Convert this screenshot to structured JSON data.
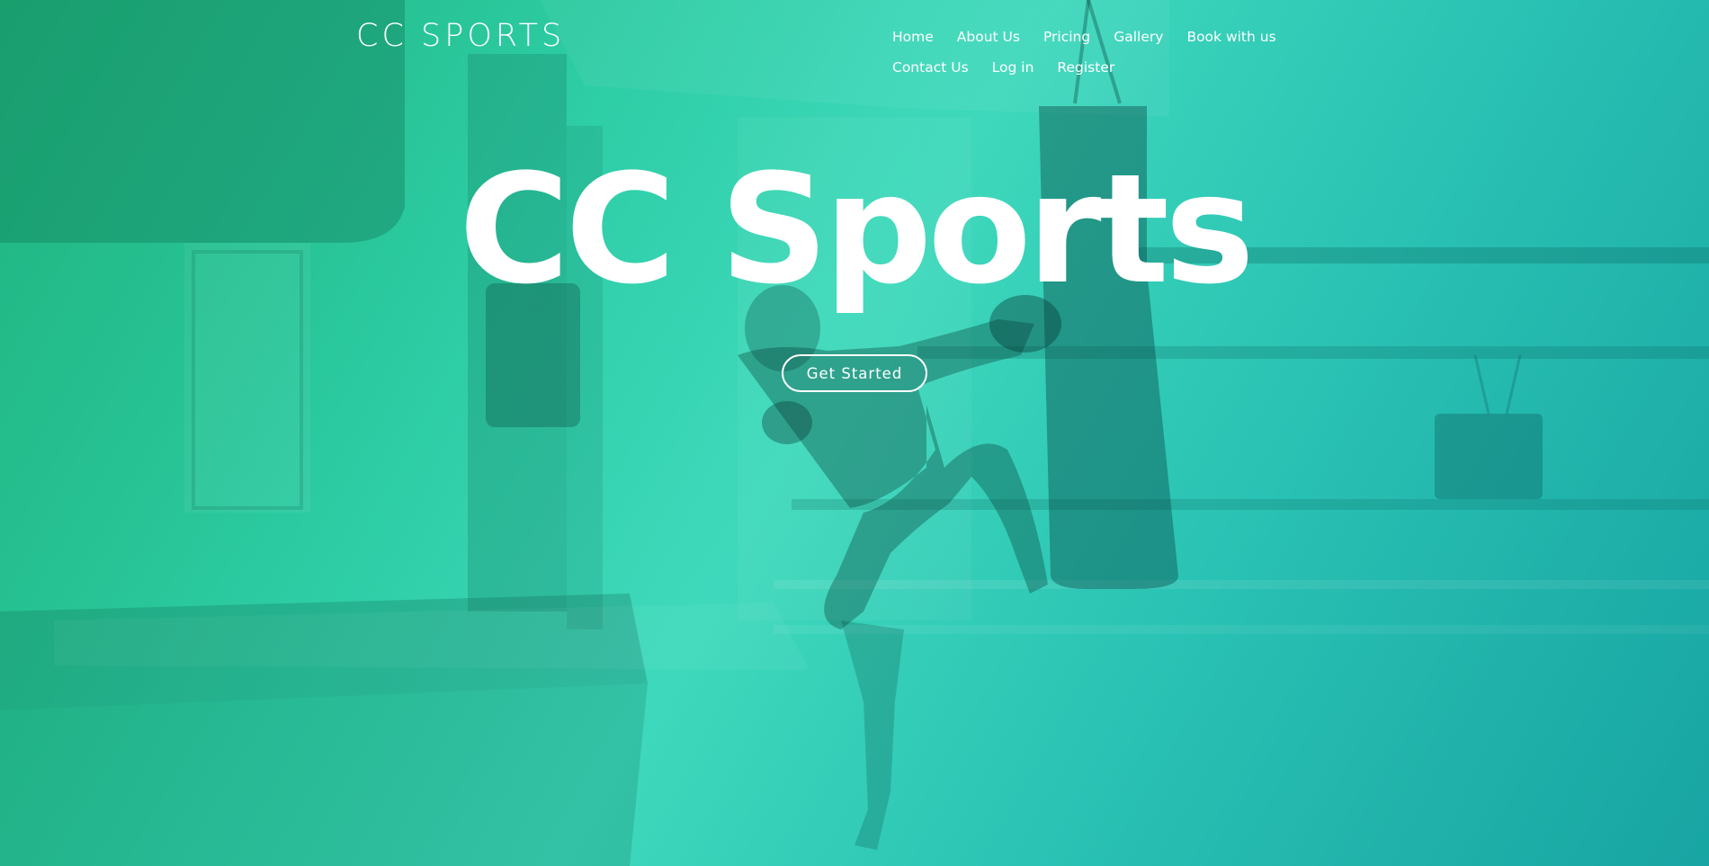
{
  "header": {
    "logo_text": "CC SPORTS",
    "nav_items": [
      {
        "label": "Home"
      },
      {
        "label": "About Us"
      },
      {
        "label": "Pricing"
      },
      {
        "label": "Gallery"
      },
      {
        "label": "Book with us"
      },
      {
        "label": "Contact Us"
      },
      {
        "label": "Log in"
      },
      {
        "label": "Register"
      }
    ]
  },
  "hero": {
    "title": "CC Sports",
    "cta_label": "Get Started",
    "background_image": "kickboxer-kicking-punching-bag-gym-photo"
  },
  "colors": {
    "gradient_start": "#1fb57f",
    "gradient_mid": "#3fd9bc",
    "gradient_end": "#1aa7a4",
    "text": "#ffffff"
  }
}
